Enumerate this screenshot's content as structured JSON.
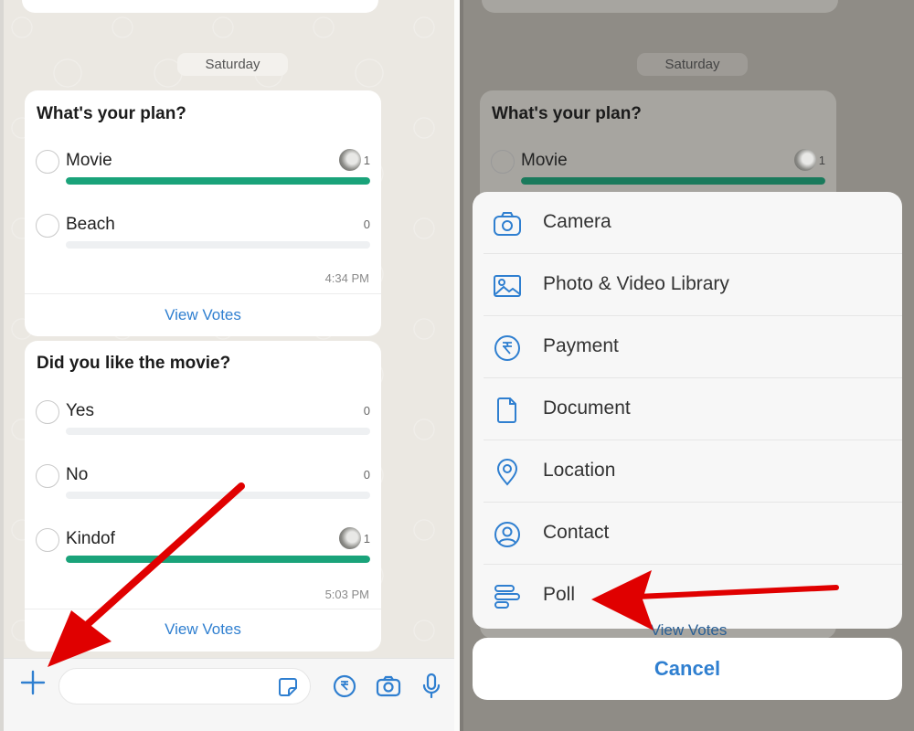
{
  "colors": {
    "accent": "#2f7fd0",
    "poll_fill": "#1aa37a",
    "annotation_arrow": "#e00000"
  },
  "left": {
    "date_chip": "Saturday",
    "polls": [
      {
        "question": "What's your plan?",
        "options": [
          {
            "label": "Movie",
            "votes": "1",
            "has_avatar": true,
            "fill_fraction": 1.0
          },
          {
            "label": "Beach",
            "votes": "0",
            "has_avatar": false,
            "fill_fraction": 0.0
          }
        ],
        "time": "4:34 PM",
        "view_votes": "View Votes"
      },
      {
        "question": "Did you like the movie?",
        "options": [
          {
            "label": "Yes",
            "votes": "0",
            "has_avatar": false,
            "fill_fraction": 0.0
          },
          {
            "label": "No",
            "votes": "0",
            "has_avatar": false,
            "fill_fraction": 0.0
          },
          {
            "label": "Kindof",
            "votes": "1",
            "has_avatar": true,
            "fill_fraction": 1.0
          }
        ],
        "time": "5:03 PM",
        "view_votes": "View Votes"
      }
    ],
    "composer": {
      "plus_icon": "plus-icon",
      "input_placeholder": "",
      "icons": [
        "sticker-icon",
        "rupee-payment-icon",
        "camera-icon",
        "microphone-icon"
      ]
    }
  },
  "right": {
    "date_chip": "Saturday",
    "poll_question": "What's your plan?",
    "poll_option": {
      "label": "Movie",
      "votes": "1"
    },
    "view_votes": "View Votes",
    "sheet": {
      "items": [
        {
          "label": "Camera",
          "icon": "camera-icon"
        },
        {
          "label": "Photo & Video Library",
          "icon": "photo-icon"
        },
        {
          "label": "Payment",
          "icon": "rupee-icon"
        },
        {
          "label": "Document",
          "icon": "document-icon"
        },
        {
          "label": "Location",
          "icon": "location-pin-icon"
        },
        {
          "label": "Contact",
          "icon": "contact-icon"
        },
        {
          "label": "Poll",
          "icon": "poll-icon"
        }
      ],
      "cancel": "Cancel"
    }
  }
}
